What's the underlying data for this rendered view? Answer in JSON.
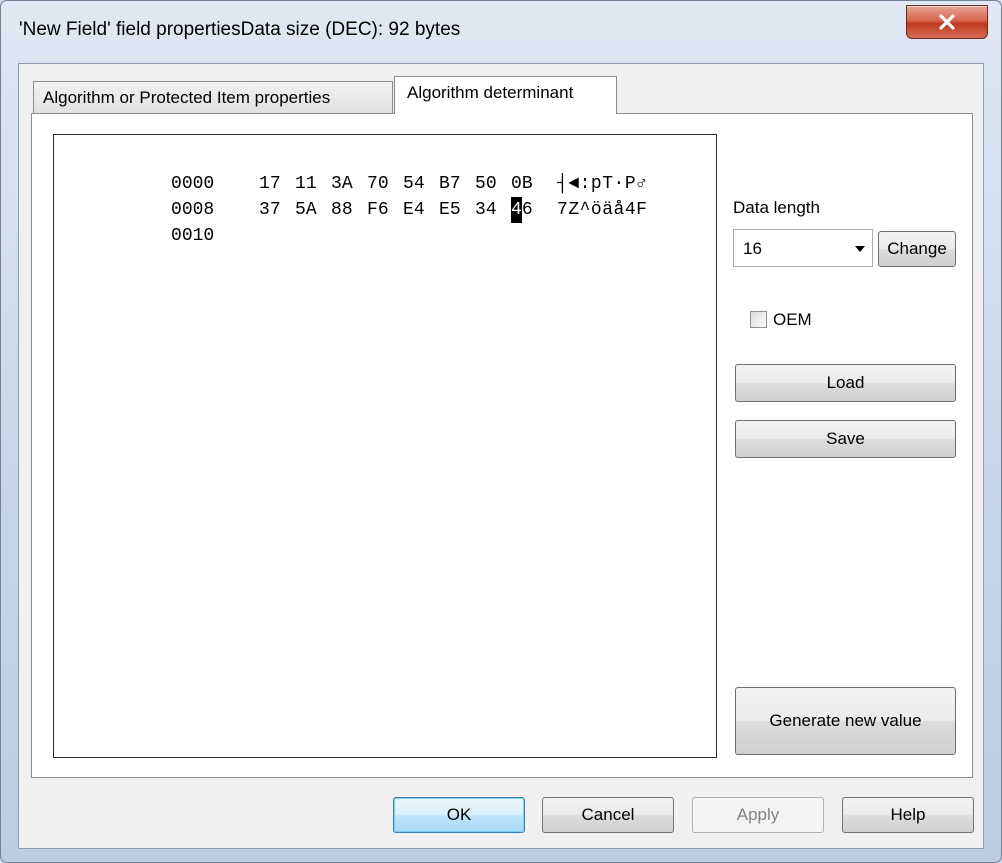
{
  "window": {
    "title": "'New Field' field propertiesData size (DEC): 92 bytes",
    "close_label": "x"
  },
  "tabs": [
    {
      "label": "Algorithm or Protected Item properties",
      "active": false
    },
    {
      "label": "Algorithm determinant",
      "active": true
    }
  ],
  "hex_view": {
    "rows": [
      {
        "offset": "0000",
        "bytes": [
          "17",
          "11",
          "3A",
          "70",
          "54",
          "B7",
          "50",
          "0B"
        ],
        "ascii": "┤◄:pT·P♂"
      },
      {
        "offset": "0008",
        "bytes": [
          "37",
          "5A",
          "88",
          "F6",
          "E4",
          "E5",
          "34",
          "46"
        ],
        "ascii": "7Z^öäå4F"
      },
      {
        "offset": "0010",
        "bytes": [],
        "ascii": ""
      }
    ],
    "cursor": {
      "row": 1,
      "byte": 7,
      "char": "4",
      "rest": "6"
    }
  },
  "side_panel": {
    "data_length_label": "Data length",
    "data_length_value": "16",
    "change_label": "Change",
    "oem_label": "OEM",
    "oem_checked": false,
    "load_label": "Load",
    "save_label": "Save",
    "generate_label": "Generate new value"
  },
  "footer": {
    "ok_label": "OK",
    "cancel_label": "Cancel",
    "apply_label": "Apply",
    "help_label": "Help"
  }
}
